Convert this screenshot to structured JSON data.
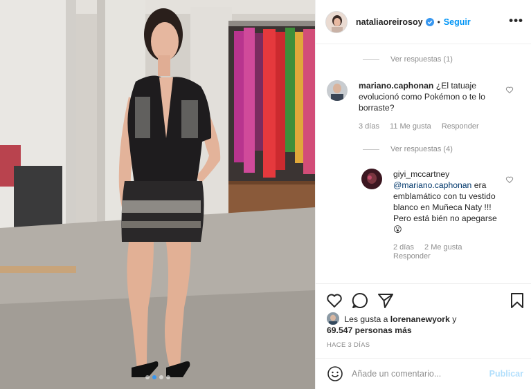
{
  "post": {
    "dots": 4,
    "active_dot": 1
  },
  "header": {
    "username": "nataliaoreirosoy",
    "verified_icon": "verified-badge-icon",
    "separator": "•",
    "follow_label": "Seguir",
    "more_label": "•••"
  },
  "comments": {
    "view_replies_1": "Ver respuestas (1)",
    "comment1": {
      "user": "mariano.caphonan",
      "text": "¿El tatuaje evolucionó como Pokémon o te lo borraste?",
      "time": "3 días",
      "likes": "11 Me gusta",
      "reply": "Responder"
    },
    "view_replies_2": "Ver respuestas (4)",
    "reply1": {
      "user": "giyi_mccartney",
      "mention": "@mariano.caphonan",
      "text": "era emblamático con tu vestido blanco en Muñeca Naty !!! Pero está bién no apegarse",
      "emoji": "😮",
      "time": "2 días",
      "likes": "2 Me gusta",
      "reply": "Responder"
    }
  },
  "likes": {
    "prefix": "Les gusta a",
    "user": "lorenanewyork",
    "joiner": "y",
    "count": "69.547 personas más"
  },
  "timestamp": "HACE 3 DÍAS",
  "add_comment": {
    "placeholder": "Añade un comentario...",
    "publish_label": "Publicar"
  },
  "colors": {
    "accent": "#0095f6",
    "publish_disabled": "#b2dffc",
    "secondary_text": "#8e8e8e",
    "mention": "#00376b"
  }
}
